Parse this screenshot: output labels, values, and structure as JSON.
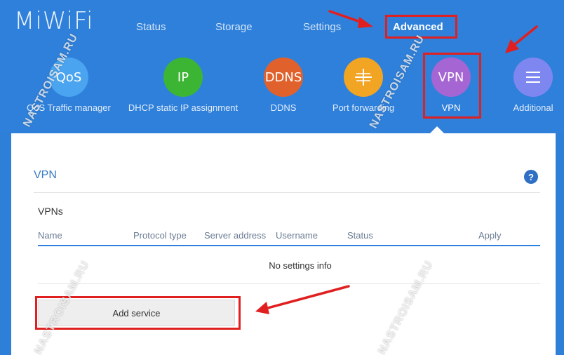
{
  "brand": {
    "logo": "MiWiFi"
  },
  "nav": [
    {
      "label": "Status"
    },
    {
      "label": "Storage"
    },
    {
      "label": "Settings"
    },
    {
      "label": "Advanced"
    }
  ],
  "tools": [
    {
      "icon_text": "QoS",
      "label": "QoS Traffic manager",
      "color": "#4aa4f0"
    },
    {
      "icon_text": "IP",
      "label": "DHCP static IP assignment",
      "color": "#3db534"
    },
    {
      "icon_text": "DDNS",
      "label": "DDNS",
      "color": "#e0612b"
    },
    {
      "icon_text": "",
      "label": "Port forwarding",
      "color": "#f2a423"
    },
    {
      "icon_text": "VPN",
      "label": "VPN",
      "color": "#a566d4"
    },
    {
      "icon_text": "",
      "label": "Additional",
      "color": "#7e86f0"
    }
  ],
  "panel": {
    "title": "VPN",
    "help": "?",
    "section_title": "VPNs",
    "columns": [
      "Name",
      "Protocol type",
      "Server address",
      "Username",
      "Status",
      "Apply"
    ],
    "empty_text": "No settings info",
    "add_button": "Add service"
  },
  "watermarks": [
    "NASTROISAM.RU",
    "NASTROISAM.RU",
    "NASTROISAM.RU",
    "NASTROISAM.RU"
  ],
  "colors": {
    "header": "#2f80da",
    "accent": "#2f80da",
    "annotation": "#e02020"
  }
}
